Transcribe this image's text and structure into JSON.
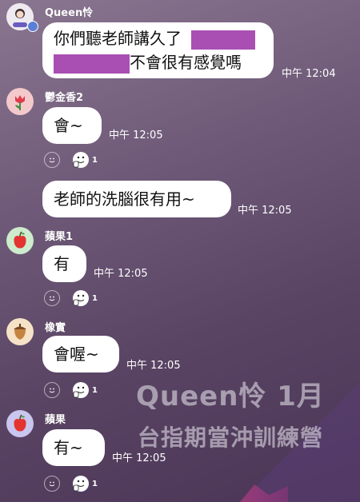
{
  "colors": {
    "background_top": "#8a7690",
    "background_bottom": "#4a3556",
    "bubble": "#ffffff",
    "redaction": "#a94fb3"
  },
  "messages": [
    {
      "sender": "Queen怜",
      "avatar_icon": "profile-photo-avatar",
      "line1_prefix": "你們聽老師講久了",
      "line2_suffix": "不會很有感覺嗎",
      "time": "中午 12:04"
    },
    {
      "sender": "鬱金香2",
      "avatar_icon": "tulip-avatar",
      "text": "會~",
      "time": "中午 12:05",
      "reaction_count": "1"
    },
    {
      "text": "老師的洗腦很有用~",
      "time": "中午 12:05"
    },
    {
      "sender": "蘋果1",
      "avatar_icon": "apple-avatar",
      "text": "有",
      "time": "中午 12:05",
      "reaction_count": "1"
    },
    {
      "sender": "橡實",
      "avatar_icon": "acorn-avatar",
      "text": "會喔~",
      "time": "中午 12:05",
      "reaction_count": "1"
    },
    {
      "sender": "蘋果",
      "avatar_icon": "apple-avatar",
      "text": "有~",
      "time": "中午 12:05",
      "reaction_count": "1"
    }
  ],
  "watermark": {
    "line1": "Queen怜  1月",
    "line2": "台指期當沖訓練營"
  }
}
